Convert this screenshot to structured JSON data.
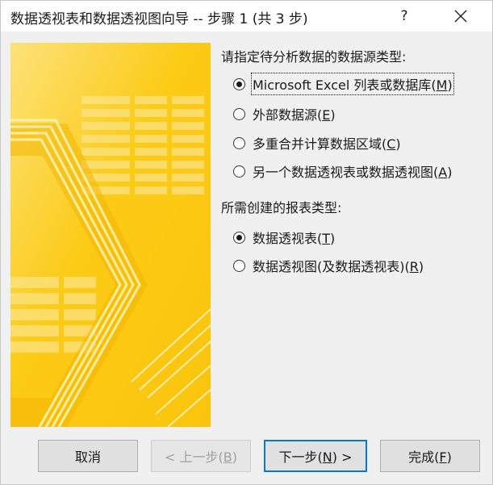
{
  "window": {
    "title": "数据透视表和数据透视图向导 -- 步骤 1 (共 3 步)",
    "help_label": "?"
  },
  "data_source": {
    "heading": "请指定待分析数据的数据源类型:",
    "options": [
      {
        "text": "Microsoft Excel 列表或数据库(",
        "key": "M",
        "tail": ")",
        "selected": true
      },
      {
        "text": "外部数据源(",
        "key": "E",
        "tail": ")",
        "selected": false
      },
      {
        "text": "多重合并计算数据区域(",
        "key": "C",
        "tail": ")",
        "selected": false
      },
      {
        "text": "另一个数据透视表或数据透视图(",
        "key": "A",
        "tail": ")",
        "selected": false
      }
    ]
  },
  "report_type": {
    "heading": "所需创建的报表类型:",
    "options": [
      {
        "text": "数据透视表(",
        "key": "T",
        "tail": ")",
        "selected": true
      },
      {
        "text": "数据透视图(及数据透视表)(",
        "key": "R",
        "tail": ")",
        "selected": false
      }
    ]
  },
  "buttons": {
    "cancel": {
      "text": "取消"
    },
    "back": {
      "text": "< 上一步(",
      "key": "B",
      "tail": ")",
      "disabled": true
    },
    "next": {
      "text": "下一步(",
      "key": "N",
      "tail": ") >",
      "default": true
    },
    "finish": {
      "text": "完成(",
      "key": "F",
      "tail": ")"
    }
  },
  "colors": {
    "banner_base": "#fccb16",
    "banner_light": "#fde27a",
    "banner_dark": "#f4b400",
    "accent_focus": "#0078d7"
  },
  "icons": [
    "close-icon",
    "help-icon",
    "wizard-banner-illustration"
  ]
}
